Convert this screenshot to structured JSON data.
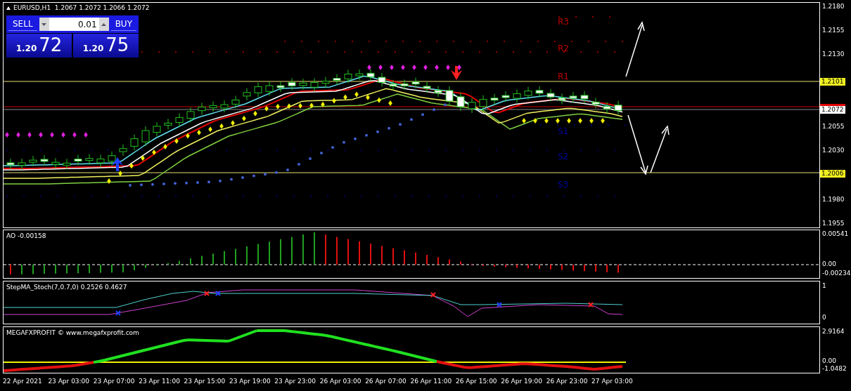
{
  "chart_window": {
    "title": "EURUSD,H1  1.2067 1.2072 1.2066 1.2072"
  },
  "trade_panel": {
    "sell_label": "SELL",
    "buy_label": "BUY",
    "lot": "0.01",
    "sell_price_big": "1.20",
    "sell_price_small": "72",
    "buy_price_big": "1.20",
    "buy_price_small": "75"
  },
  "pivot_labels": [
    {
      "text": "R3",
      "color": "#c00000"
    },
    {
      "text": "R2",
      "color": "#c00000"
    },
    {
      "text": "R1",
      "color": "#c00000"
    },
    {
      "text": "S1",
      "color": "#0000a0"
    },
    {
      "text": "S2",
      "color": "#0000a0"
    },
    {
      "text": "S3",
      "color": "#0000a0"
    }
  ],
  "price_axis": {
    "ticks": [
      "1.2180",
      "1.2155",
      "1.2130",
      "1.2055",
      "1.2030",
      "1.1980",
      "1.1955"
    ],
    "tags": [
      {
        "text": "1.2101",
        "kind": "level"
      },
      {
        "text": "1.2072",
        "kind": "bid"
      },
      {
        "text": "1.2006",
        "kind": "level"
      }
    ]
  },
  "indicators": [
    {
      "label": "AO -0.00158",
      "axis": [
        "0.00541",
        "0.00",
        "-0.00234"
      ]
    },
    {
      "label": "StepMA_Stoch(7,0.7,0) 0.2526 0.4627",
      "axis": [
        "1",
        "0"
      ]
    },
    {
      "label": "MEGAFXPROFIT © www.megafxprofit.com",
      "axis": [
        "2.9164",
        "0.00",
        "-1.0482"
      ]
    }
  ],
  "time_axis": [
    "22 Apr 2021",
    "23 Apr 03:00",
    "23 Apr 07:00",
    "23 Apr 11:00",
    "23 Apr 15:00",
    "23 Apr 19:00",
    "23 Apr 23:00",
    "26 Apr 03:00",
    "26 Apr 07:00",
    "26 Apr 11:00",
    "26 Apr 15:00",
    "26 Apr 19:00",
    "26 Apr 23:00",
    "27 Apr 03:00"
  ]
}
